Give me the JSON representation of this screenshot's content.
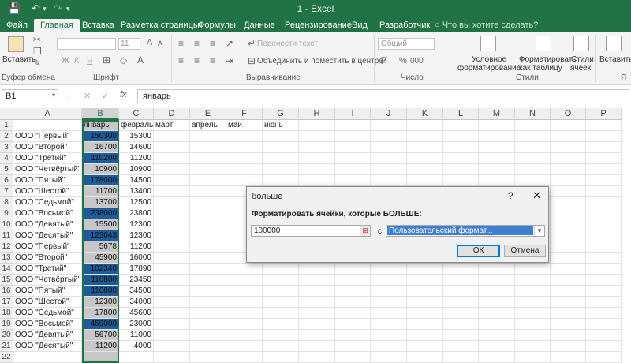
{
  "window": {
    "title": "1 - Excel"
  },
  "quick_access": {
    "save_icon": "save-icon",
    "undo_icon": "undo-icon",
    "redo_icon": "redo-icon"
  },
  "tabs": [
    {
      "label": "Файл"
    },
    {
      "label": "Главная"
    },
    {
      "label": "Вставка"
    },
    {
      "label": "Разметка страницы"
    },
    {
      "label": "Формулы"
    },
    {
      "label": "Данные"
    },
    {
      "label": "Рецензирование"
    },
    {
      "label": "Вид"
    },
    {
      "label": "Разработчик"
    }
  ],
  "tell_me": "Что вы хотите сделать?",
  "ribbon": {
    "paste": "Вставить",
    "clipboard_group": "Буфер обмена",
    "font_group": "Шрифт",
    "font_size": "11",
    "bold": "Ж",
    "italic": "К",
    "underline": "Ч",
    "wrap_text": "Перенести текст",
    "merge": "Объединить и поместить в центре",
    "align_group": "Выравнивание",
    "number_format": "Общий",
    "percent": "%",
    "thousands": "000",
    "number_group": "Число",
    "conditional_1": "Условное",
    "conditional_2": "форматирование",
    "format_table_1": "Форматировать",
    "format_table_2": "как таблицу",
    "cell_styles_1": "Стили",
    "cell_styles_2": "ячеек",
    "styles_group": "Стили",
    "insert": "Вставить",
    "cells_group": "Я"
  },
  "formula_bar": {
    "name_box": "B1",
    "cancel": "✕",
    "confirm": "✓",
    "fx": "fx",
    "value": "январь"
  },
  "columns": [
    "A",
    "B",
    "C",
    "D",
    "E",
    "F",
    "G",
    "H",
    "I",
    "J",
    "K",
    "L",
    "M",
    "N",
    "O",
    "P"
  ],
  "rows": [
    {
      "n": "1",
      "a": "",
      "b": "январь",
      "c": "февраль",
      "d": "март",
      "e": "апрель",
      "f": "май",
      "g": "июнь"
    },
    {
      "n": "2",
      "a": "ООО \"Первый\"",
      "b": "150300",
      "c": "15300",
      "hl": true
    },
    {
      "n": "3",
      "a": "ООО \"Второй\"",
      "b": "16700",
      "c": "14600",
      "hl": false
    },
    {
      "n": "4",
      "a": "ООО \"Третий\"",
      "b": "110200",
      "c": "11200",
      "hl": true
    },
    {
      "n": "5",
      "a": "ООО \"Четвёртый\"",
      "b": "10900",
      "c": "10900",
      "hl": false
    },
    {
      "n": "6",
      "a": "ООО \"Пятый\"",
      "b": "178000",
      "c": "14500",
      "hl": true
    },
    {
      "n": "7",
      "a": "ООО \"Шестой\"",
      "b": "11700",
      "c": "13400",
      "hl": false
    },
    {
      "n": "8",
      "a": "ООО \"Седьмой\"",
      "b": "13700",
      "c": "12500",
      "hl": false
    },
    {
      "n": "9",
      "a": "ООО \"Восьмой\"",
      "b": "238000",
      "c": "23800",
      "hl": true
    },
    {
      "n": "10",
      "a": "ООО \"Девятый\"",
      "b": "15500",
      "c": "12300",
      "hl": false
    },
    {
      "n": "11",
      "a": "ООО \"Десятый\"",
      "b": "123043",
      "c": "12300",
      "hl": true
    },
    {
      "n": "12",
      "a": "ООО \"Первый\"",
      "b": "5678",
      "c": "11200",
      "hl": false
    },
    {
      "n": "13",
      "a": "ООО \"Второй\"",
      "b": "45900",
      "c": "16000",
      "hl": false
    },
    {
      "n": "14",
      "a": "ООО \"Третий\"",
      "b": "102340",
      "c": "17890",
      "hl": true
    },
    {
      "n": "15",
      "a": "ООО \"Четвёртый\"",
      "b": "110800",
      "c": "23450",
      "hl": true
    },
    {
      "n": "16",
      "a": "ООО \"Пятый\"",
      "b": "110800",
      "c": "34500",
      "hl": true
    },
    {
      "n": "17",
      "a": "ООО \"Шестой\"",
      "b": "12300",
      "c": "34000",
      "hl": false
    },
    {
      "n": "18",
      "a": "ООО \"Седьмой\"",
      "b": "17800",
      "c": "45600",
      "hl": false
    },
    {
      "n": "19",
      "a": "ООО \"Восьмой\"",
      "b": "459000",
      "c": "23000",
      "hl": true
    },
    {
      "n": "20",
      "a": "ООО \"Девятый\"",
      "b": "56700",
      "c": "11000",
      "hl": false
    },
    {
      "n": "21",
      "a": "ООО \"Десятый\"",
      "b": "11200",
      "c": "4000",
      "hl": false
    },
    {
      "n": "22",
      "a": "",
      "b": "",
      "c": "",
      "hl": false
    }
  ],
  "dialog": {
    "title": "больше",
    "help": "?",
    "close": "✕",
    "label": "Форматировать ячейки, которые БОЛЬШЕ:",
    "value": "100000",
    "with_label": "с",
    "format": "Пользовательский формат...",
    "ok": "ОК",
    "cancel": "Отмена"
  },
  "colors": {
    "excel_green": "#217346",
    "highlight": "#1f5c9a",
    "selection_grey": "#c7c7c7"
  }
}
